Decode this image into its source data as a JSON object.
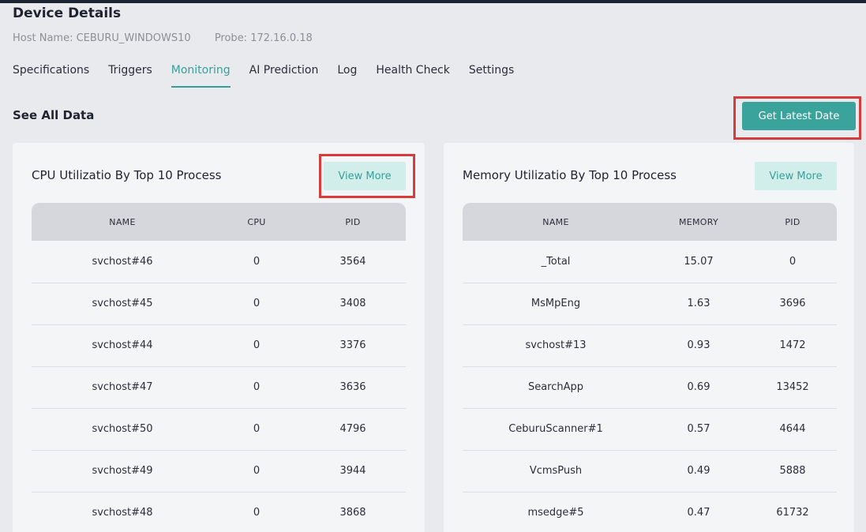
{
  "page": {
    "title": "Device Details",
    "host_name": "Host Name: CEBURU_WINDOWS10",
    "probe": "Probe: 172.16.0.18"
  },
  "tabs": [
    {
      "label": "Specifications",
      "active": false
    },
    {
      "label": "Triggers",
      "active": false
    },
    {
      "label": "Monitoring",
      "active": true
    },
    {
      "label": "AI Prediction",
      "active": false
    },
    {
      "label": "Log",
      "active": false
    },
    {
      "label": "Health Check",
      "active": false
    },
    {
      "label": "Settings",
      "active": false
    }
  ],
  "section": {
    "title": "See All Data",
    "latest_button": "Get Latest Date"
  },
  "colors": {
    "accent": "#3aa39c",
    "highlight": "#d93a3a",
    "button_light": "#d1eeeb"
  },
  "cpu_card": {
    "title": "CPU Utilizatio By Top 10 Process",
    "view_more": "View More",
    "headers": [
      "NAME",
      "CPU",
      "PID"
    ],
    "rows": [
      [
        "svchost#46",
        "0",
        "3564"
      ],
      [
        "svchost#45",
        "0",
        "3408"
      ],
      [
        "svchost#44",
        "0",
        "3376"
      ],
      [
        "svchost#47",
        "0",
        "3636"
      ],
      [
        "svchost#50",
        "0",
        "4796"
      ],
      [
        "svchost#49",
        "0",
        "3944"
      ],
      [
        "svchost#48",
        "0",
        "3868"
      ]
    ]
  },
  "memory_card": {
    "title": "Memory Utilizatio By Top 10 Process",
    "view_more": "View More",
    "headers": [
      "NAME",
      "MEMORY",
      "PID"
    ],
    "rows": [
      [
        "_Total",
        "15.07",
        "0"
      ],
      [
        "MsMpEng",
        "1.63",
        "3696"
      ],
      [
        "svchost#13",
        "0.93",
        "1472"
      ],
      [
        "SearchApp",
        "0.69",
        "13452"
      ],
      [
        "CeburuScanner#1",
        "0.57",
        "4644"
      ],
      [
        "VcmsPush",
        "0.49",
        "5888"
      ],
      [
        "msedge#5",
        "0.47",
        "61732"
      ]
    ]
  }
}
